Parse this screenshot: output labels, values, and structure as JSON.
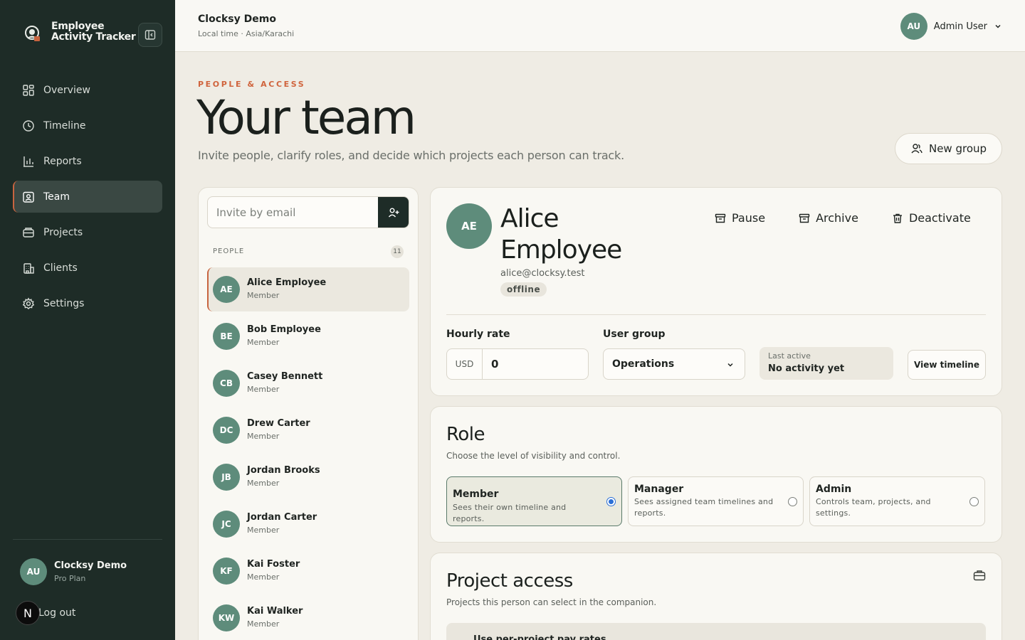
{
  "app": {
    "name": "Employee Activity Tracker"
  },
  "sidebar": {
    "items": [
      {
        "label": "Overview",
        "icon": "grid-icon"
      },
      {
        "label": "Timeline",
        "icon": "clock-icon"
      },
      {
        "label": "Reports",
        "icon": "bar-chart-icon"
      },
      {
        "label": "Team",
        "icon": "badge-icon",
        "active": true
      },
      {
        "label": "Projects",
        "icon": "stack-icon"
      },
      {
        "label": "Clients",
        "icon": "building-icon"
      },
      {
        "label": "Settings",
        "icon": "gear-icon"
      }
    ],
    "account": {
      "initials": "AU",
      "name": "Clocksy Demo",
      "plan": "Pro Plan"
    },
    "logout_label": "Log out",
    "logout_badge": "N"
  },
  "topbar": {
    "title": "Clocksy Demo",
    "subtitle": "Local time · Asia/Karachi",
    "user_initials": "AU",
    "user_name": "Admin User"
  },
  "header": {
    "eyebrow": "PEOPLE & ACCESS",
    "title": "Your team",
    "subtitle": "Invite people, clarify roles, and decide which projects each person can track.",
    "new_group_label": "New group"
  },
  "people": {
    "invite_placeholder": "Invite by email",
    "section_label": "PEOPLE",
    "count": "11",
    "list": [
      {
        "initials": "AE",
        "name": "Alice Employee",
        "role": "Member"
      },
      {
        "initials": "BE",
        "name": "Bob Employee",
        "role": "Member"
      },
      {
        "initials": "CB",
        "name": "Casey Bennett",
        "role": "Member"
      },
      {
        "initials": "DC",
        "name": "Drew Carter",
        "role": "Member"
      },
      {
        "initials": "JB",
        "name": "Jordan Brooks",
        "role": "Member"
      },
      {
        "initials": "JC",
        "name": "Jordan Carter",
        "role": "Member"
      },
      {
        "initials": "KF",
        "name": "Kai Foster",
        "role": "Member"
      },
      {
        "initials": "KW",
        "name": "Kai Walker",
        "role": "Member"
      }
    ]
  },
  "profile": {
    "initials": "AE",
    "name": "Alice Employee",
    "email": "alice@clocksy.test",
    "status": "offline",
    "actions": {
      "pause": "Pause",
      "archive": "Archive",
      "deactivate": "Deactivate"
    },
    "hourly_rate_label": "Hourly rate",
    "currency": "USD",
    "hourly_rate": "0",
    "user_group_label": "User group",
    "user_group": "Operations",
    "last_active_label": "Last active",
    "last_active": "No activity yet",
    "view_timeline_label": "View timeline"
  },
  "role": {
    "title": "Role",
    "subtitle": "Choose the level of visibility and control.",
    "options": [
      {
        "title": "Member",
        "desc": "Sees their own timeline and reports.",
        "selected": true
      },
      {
        "title": "Manager",
        "desc": "Sees assigned team timelines and reports.",
        "selected": false
      },
      {
        "title": "Admin",
        "desc": "Controls team, projects, and settings.",
        "selected": false
      }
    ]
  },
  "access": {
    "title": "Project access",
    "subtitle": "Projects this person can select in the companion.",
    "rates_label": "Use per-project pay rates"
  },
  "colors": {
    "sidebar_bg": "#1e2c27",
    "accent": "#c8643f",
    "avatar": "#5e8c7b",
    "page_bg": "#efece4"
  }
}
